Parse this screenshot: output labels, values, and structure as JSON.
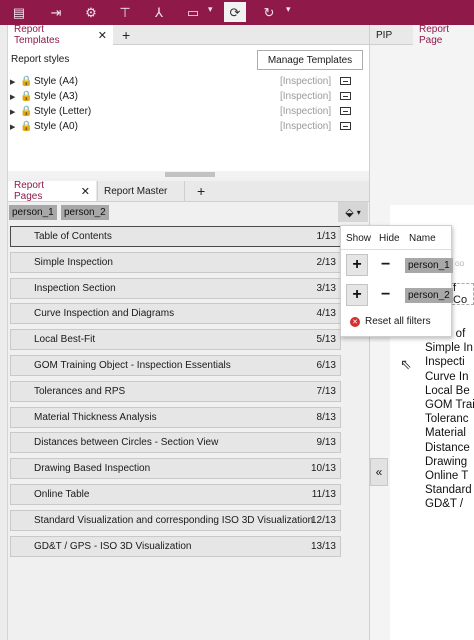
{
  "toolbar": {
    "buttons": [
      "report-icon",
      "export-icon",
      "settings-gear-icon",
      "pin-icon",
      "pdf-icon",
      "monitor-icon",
      "refresh-icon",
      "redo-icon"
    ]
  },
  "left_tabs": {
    "report_templates": "Report Templates"
  },
  "right_tabs": {
    "pip": "PIP",
    "report_page": "Report Page"
  },
  "templates": {
    "heading": "Report styles",
    "manage_button": "Manage Templates",
    "items": [
      {
        "name": "Style (A4)",
        "tag": "[Inspection]"
      },
      {
        "name": "Style (A3)",
        "tag": "[Inspection]"
      },
      {
        "name": "Style (Letter)",
        "tag": "[Inspection]"
      },
      {
        "name": "Style (A0)",
        "tag": "[Inspection]"
      }
    ]
  },
  "pages_tabs": {
    "report_pages": "Report Pages",
    "report_master": "Report Master"
  },
  "filters": {
    "chips": [
      "person_1",
      "person_2"
    ]
  },
  "pages": [
    {
      "title": "Table of Contents",
      "count": "1/13"
    },
    {
      "title": "Simple Inspection",
      "count": "2/13"
    },
    {
      "title": "Inspection Section",
      "count": "3/13"
    },
    {
      "title": "Curve Inspection and Diagrams",
      "count": "4/13"
    },
    {
      "title": "Local Best-Fit",
      "count": "5/13"
    },
    {
      "title": "GOM Training Object - Inspection Essentials",
      "count": "6/13"
    },
    {
      "title": "Tolerances and RPS",
      "count": "7/13"
    },
    {
      "title": "Material Thickness Analysis",
      "count": "8/13"
    },
    {
      "title": "Distances between Circles - Section View",
      "count": "9/13"
    },
    {
      "title": "Drawing Based Inspection",
      "count": "10/13"
    },
    {
      "title": "Online Table",
      "count": "11/13"
    },
    {
      "title": "Standard Visualization and corresponding ISO 3D Visualization",
      "count": "12/13"
    },
    {
      "title": "GD&T / GPS - ISO 3D Visualization",
      "count": "13/13"
    }
  ],
  "filter_popup": {
    "headers": {
      "show": "Show",
      "hide": "Hide",
      "name": "Name"
    },
    "rows": [
      "person_1",
      "person_2"
    ],
    "reset": "Reset all filters"
  },
  "collapse_button": "«",
  "preview": {
    "partial_lines": [
      "Table of",
      "Simple In",
      "Inspecti",
      "Curve In",
      "Local Be",
      "GOM Trai",
      "Toleranc",
      "Material",
      "Distance",
      "Drawing",
      "Online T",
      "Standard",
      "GD&T / "
    ],
    "toc_fragment": "f Co",
    "doc_fragment": "GO"
  }
}
